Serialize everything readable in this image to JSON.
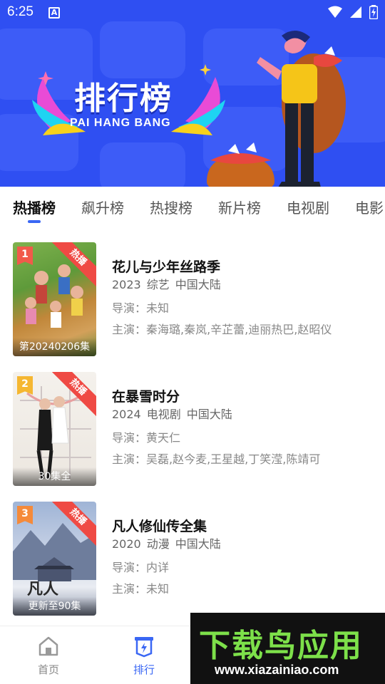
{
  "status_bar": {
    "time": "6:25",
    "notification_letter": "A"
  },
  "banner": {
    "title": "排行榜",
    "subtitle": "PAI HANG BANG"
  },
  "tabs": [
    {
      "label": "热播榜",
      "active": true
    },
    {
      "label": "飙升榜",
      "active": false
    },
    {
      "label": "热搜榜",
      "active": false
    },
    {
      "label": "新片榜",
      "active": false
    },
    {
      "label": "电视剧",
      "active": false
    },
    {
      "label": "电影",
      "active": false
    }
  ],
  "list": [
    {
      "rank": "1",
      "badge": "热播",
      "episode": "第20240206集",
      "title": "花儿与少年丝路季",
      "year": "2023",
      "genre": "综艺",
      "region": "中国大陆",
      "director": "导演：未知",
      "cast": "主演：秦海璐,秦岚,辛芷蕾,迪丽热巴,赵昭仪"
    },
    {
      "rank": "2",
      "badge": "热播",
      "episode": "30集全",
      "title": "在暴雪时分",
      "year": "2024",
      "genre": "电视剧",
      "region": "中国大陆",
      "director": "导演：黄天仁",
      "cast": "主演：吴磊,赵今麦,王星越,丁笑滢,陈靖可"
    },
    {
      "rank": "3",
      "badge": "热播",
      "episode": "更新至90集",
      "title": "凡人修仙传全集",
      "year": "2020",
      "genre": "动漫",
      "region": "中国大陆",
      "director": "导演：内详",
      "cast": "主演：未知"
    }
  ],
  "bottom_nav": [
    {
      "label": "首页",
      "icon": "home-icon",
      "active": false
    },
    {
      "label": "排行",
      "icon": "rank-icon",
      "active": true
    }
  ],
  "watermark": {
    "name": "下载鸟应用",
    "url": "www.xiazainiao.com"
  },
  "colors": {
    "banner_bg": "#2f4ff2",
    "accent": "#3a67f4",
    "badge_red": "#ef4a44",
    "rank_1": "#f15a4a",
    "rank_2": "#f5b731",
    "rank_3": "#f58a3a",
    "watermark_green": "#7de04a"
  }
}
